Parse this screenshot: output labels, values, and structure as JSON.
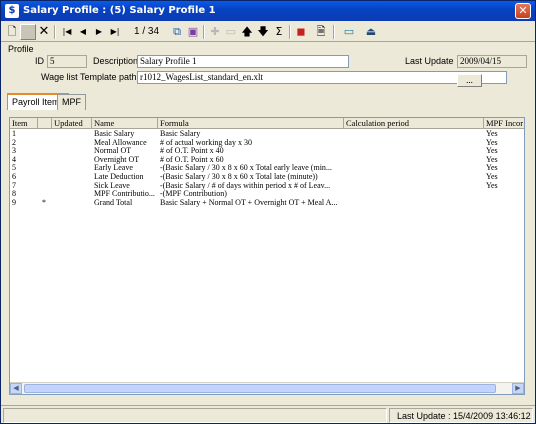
{
  "window": {
    "title": "Salary Profile : (5) Salary Profile 1"
  },
  "toolbar": {
    "page_counter": "1 / 34"
  },
  "profile": {
    "group_label": "Profile",
    "id_label": "ID",
    "id_value": "5",
    "description_label": "Description",
    "description_value": "Salary Profile 1",
    "last_update_label": "Last Update",
    "last_update_value": "2009/04/15",
    "template_label": "Wage list Template path",
    "template_value": "r1012_WagesList_standard_en.xlt",
    "browse_label": "..."
  },
  "tabs": [
    {
      "label": "Payroll Items"
    },
    {
      "label": "MPF"
    }
  ],
  "grid": {
    "columns": [
      "Item",
      "",
      "Updated",
      "Name",
      "Formula",
      "Calculation period",
      "MPF Incor"
    ],
    "rows": [
      {
        "item": "1",
        "mark": "",
        "updated": "",
        "name": "Basic Salary",
        "formula": "Basic Salary",
        "period": "",
        "mpf": "Yes"
      },
      {
        "item": "2",
        "mark": "",
        "updated": "",
        "name": "Meal Allowance",
        "formula": "# of actual working day x 30",
        "period": "",
        "mpf": "Yes"
      },
      {
        "item": "3",
        "mark": "",
        "updated": "",
        "name": "Normal OT",
        "formula": "# of O.T. Point x 40",
        "period": "",
        "mpf": "Yes"
      },
      {
        "item": "4",
        "mark": "",
        "updated": "",
        "name": "Overnight OT",
        "formula": "# of O.T. Point x 60",
        "period": "",
        "mpf": "Yes"
      },
      {
        "item": "5",
        "mark": "",
        "updated": "",
        "name": "Early Leave",
        "formula": "-(Basic Salary / 30 x 8 x 60 x Total early leave (min...",
        "period": "",
        "mpf": "Yes"
      },
      {
        "item": "6",
        "mark": "",
        "updated": "",
        "name": "Late Deduction",
        "formula": "-(Basic Salary / 30 x 8 x 60 x Total late (minute))",
        "period": "",
        "mpf": "Yes"
      },
      {
        "item": "7",
        "mark": "",
        "updated": "",
        "name": "Sick Leave",
        "formula": "-(Basic Salary / # of days within period x # of  Leav...",
        "period": "",
        "mpf": "Yes"
      },
      {
        "item": "8",
        "mark": "",
        "updated": "",
        "name": "MPF Contributio...",
        "formula": "-(MPF Contribution)",
        "period": "",
        "mpf": ""
      },
      {
        "item": "9",
        "mark": "*",
        "updated": "",
        "name": "Grand Total",
        "formula": "Basic Salary + Normal OT + Overnight OT + Meal A...",
        "period": "",
        "mpf": ""
      }
    ]
  },
  "status": {
    "text": "Last Update : 15/4/2009 13:46:12"
  }
}
